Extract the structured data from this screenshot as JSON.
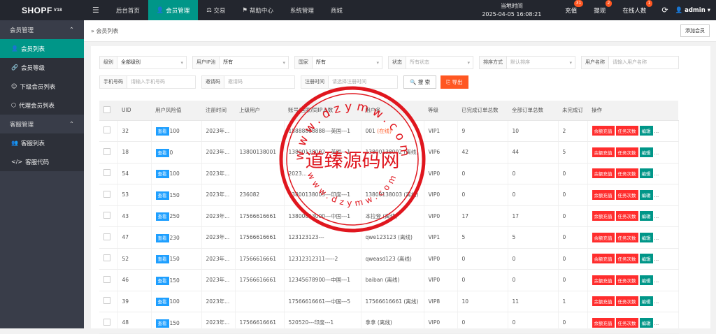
{
  "topbar": {
    "logo": "SHOPF",
    "logo_sup": "V18",
    "nav": [
      "后台首页",
      "会员管理",
      "交易",
      "帮助中心",
      "系统管理",
      "商城"
    ],
    "time_label": "当地时间",
    "time_value": "2025-04-05 16:08:21",
    "recharge": "充值",
    "recharge_badge": "31",
    "withdraw": "提现",
    "withdraw_badge": "2",
    "online": "在线人数",
    "online_badge": "1",
    "user": "admin"
  },
  "sidebar": {
    "group1": "会员管理",
    "items1": [
      "会员列表",
      "会员等级",
      "下级会员列表",
      "代理会员列表"
    ],
    "group2": "客服管理",
    "items2": [
      "客服列表",
      "客服代码"
    ]
  },
  "crumb": {
    "label": "会员列表",
    "add_button": "添加会员"
  },
  "filters": {
    "level_label": "级别",
    "level_value": "全部级别",
    "ip_label": "用户IP池",
    "ip_value": "所有",
    "country_label": "国家",
    "country_value": "所有",
    "status_label": "状态",
    "status_placeholder": "所有状态",
    "sort_label": "排序方式",
    "sort_placeholder": "默认排序",
    "username_label": "用户名称",
    "username_placeholder": "请输入用户名称",
    "phone_label": "手机号码",
    "phone_placeholder": "请输入手机号码",
    "invite_label": "邀请码",
    "invite_placeholder": "邀请码",
    "regtime_label": "注册时间",
    "regtime_placeholder": "请选择注册时间",
    "search_button": "搜 索",
    "export_button": "导出"
  },
  "table": {
    "headers": [
      "UID",
      "用户风险值",
      "注册时间",
      "上级用户",
      "账号/国家/同IP人数",
      "用户名",
      "等级",
      "已完成订单总数",
      "全部订单总数",
      "未完成订",
      "操作"
    ],
    "view_label": "查看",
    "actions": [
      "余额充值",
      "任务次数",
      "编辑",
      "..."
    ],
    "rows": [
      {
        "uid": "32",
        "risk": "100",
        "reg": "2023年...",
        "parent": "",
        "account": "18888888888---英国---1",
        "name": "001",
        "status": "(在线)",
        "level": "VIP1",
        "done": "9",
        "total": "10",
        "undone": "2"
      },
      {
        "uid": "18",
        "risk": "0",
        "reg": "2023年...",
        "parent": "13800138001",
        "account": "13800138002---英国---1",
        "name": "13800138002",
        "status": "(离线)",
        "level": "VIP6",
        "done": "42",
        "total": "44",
        "undone": "5"
      },
      {
        "uid": "54",
        "risk": "100",
        "reg": "2023年...",
        "parent": "",
        "account": "2023...",
        "name": "",
        "status": "",
        "level": "VIP0",
        "done": "0",
        "total": "0",
        "undone": "0"
      },
      {
        "uid": "53",
        "risk": "150",
        "reg": "2023年...",
        "parent": "236082",
        "account": "13800138003---印度---1",
        "name": "13800138003",
        "status": "(离线)",
        "level": "VIP0",
        "done": "0",
        "total": "0",
        "undone": "0"
      },
      {
        "uid": "43",
        "risk": "250",
        "reg": "2023年...",
        "parent": "17566616661",
        "account": "13800013000---中国---1",
        "name": "本拉登",
        "status": "(离线)",
        "level": "VIP0",
        "done": "17",
        "total": "17",
        "undone": "0"
      },
      {
        "uid": "47",
        "risk": "230",
        "reg": "2023年...",
        "parent": "17566616661",
        "account": "123123123---",
        "name": "qwe123123",
        "status": "(离线)",
        "level": "VIP1",
        "done": "5",
        "total": "5",
        "undone": "0"
      },
      {
        "uid": "52",
        "risk": "150",
        "reg": "2023年...",
        "parent": "17566616661",
        "account": "12312312311-----2",
        "name": "qweasd123",
        "status": "(离线)",
        "level": "VIP0",
        "done": "0",
        "total": "0",
        "undone": "0"
      },
      {
        "uid": "46",
        "risk": "150",
        "reg": "2023年...",
        "parent": "17566616661",
        "account": "12345678900---中国---1",
        "name": "baiban",
        "status": "(离线)",
        "level": "VIP0",
        "done": "0",
        "total": "0",
        "undone": "0"
      },
      {
        "uid": "39",
        "risk": "100",
        "reg": "2023年...",
        "parent": "",
        "account": "17566616661---中国---5",
        "name": "17566616661",
        "status": "(离线)",
        "level": "VIP8",
        "done": "10",
        "total": "11",
        "undone": "1"
      },
      {
        "uid": "48",
        "risk": "150",
        "reg": "2023年...",
        "parent": "17566616661",
        "account": "520520---印度---1",
        "name": "拿拿",
        "status": "(离线)",
        "level": "VIP0",
        "done": "0",
        "total": "0",
        "undone": "0"
      }
    ]
  },
  "stamp": {
    "text": "道臻源码网",
    "top_text": "www.dzymw.com",
    "bottom_text": "www.dzymw.com",
    "color": "#e0161e"
  }
}
